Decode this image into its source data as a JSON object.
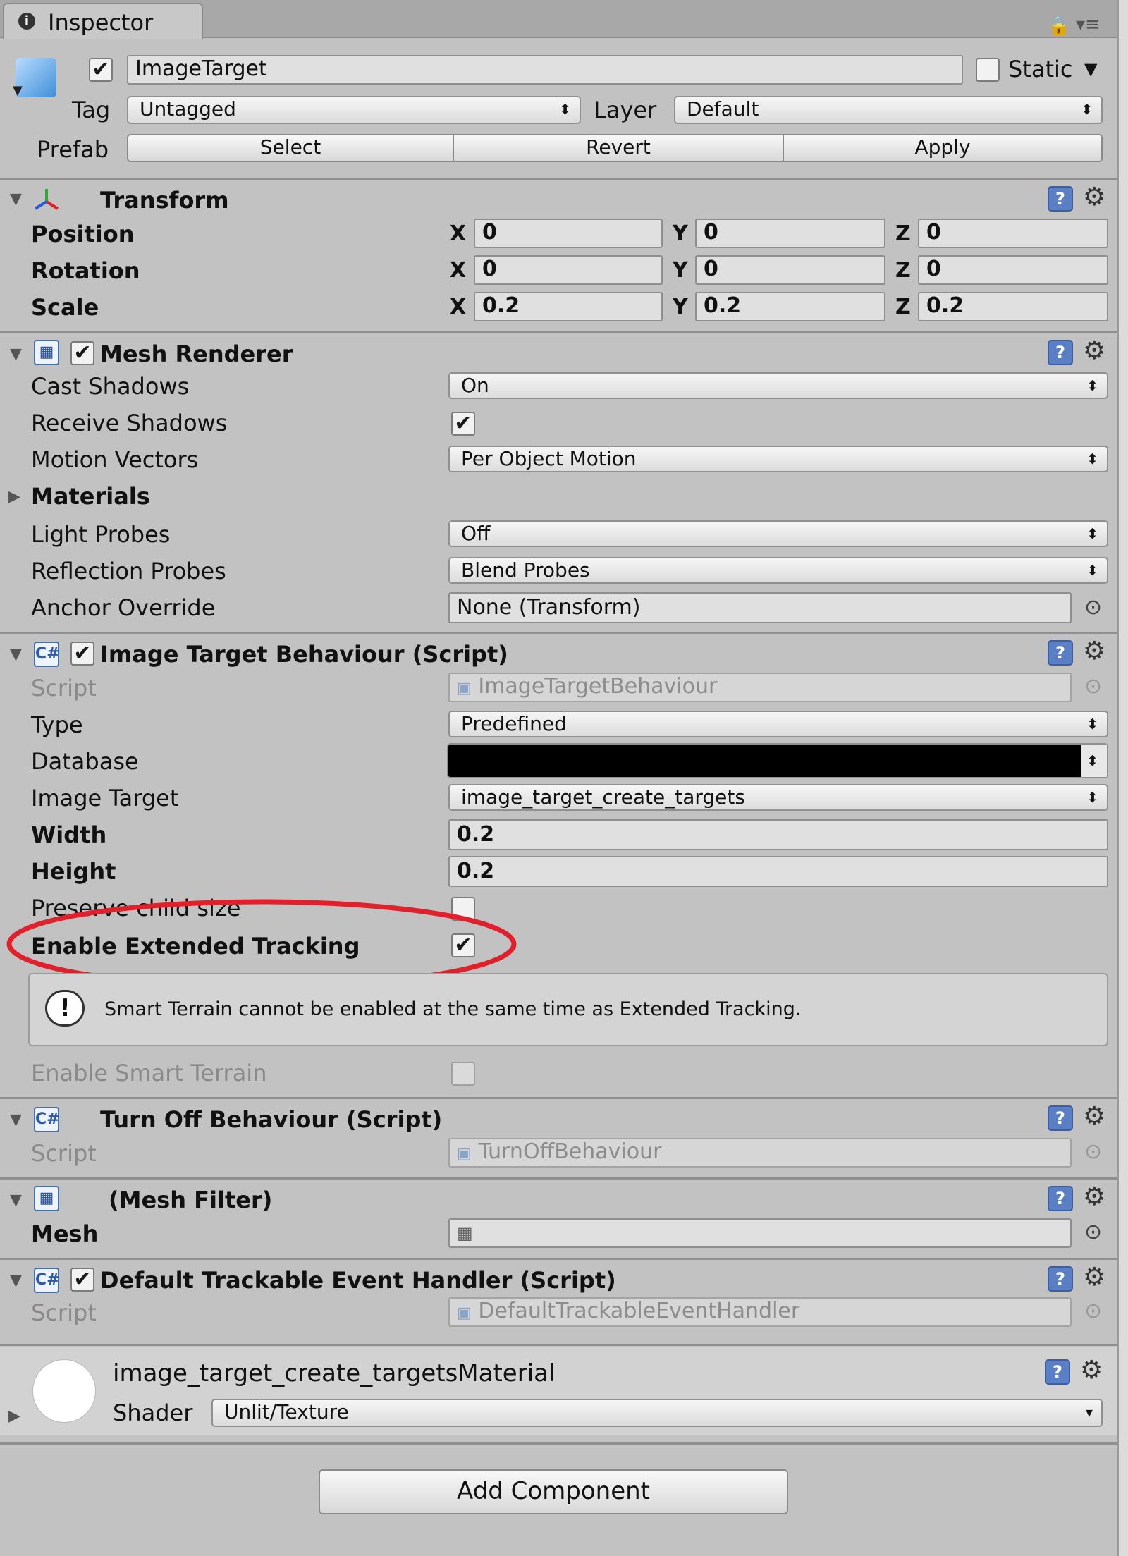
{
  "tab": {
    "title": "Inspector"
  },
  "header": {
    "object_name": "ImageTarget",
    "active": true,
    "static_label": "Static",
    "tag_label": "Tag",
    "tag_value": "Untagged",
    "layer_label": "Layer",
    "layer_value": "Default",
    "prefab_label": "Prefab",
    "prefab_buttons": [
      "Select",
      "Revert",
      "Apply"
    ]
  },
  "transform": {
    "title": "Transform",
    "rows": [
      {
        "label": "Position",
        "x": "0",
        "y": "0",
        "z": "0"
      },
      {
        "label": "Rotation",
        "x": "0",
        "y": "0",
        "z": "0"
      },
      {
        "label": "Scale",
        "x": "0.2",
        "y": "0.2",
        "z": "0.2"
      }
    ],
    "axis_labels": [
      "X",
      "Y",
      "Z"
    ]
  },
  "mesh_renderer": {
    "title": "Mesh Renderer",
    "cast_shadows_label": "Cast Shadows",
    "cast_shadows_value": "On",
    "receive_shadows_label": "Receive Shadows",
    "motion_vectors_label": "Motion Vectors",
    "motion_vectors_value": "Per Object Motion",
    "materials_label": "Materials",
    "light_probes_label": "Light Probes",
    "light_probes_value": "Off",
    "reflection_probes_label": "Reflection Probes",
    "reflection_probes_value": "Blend Probes",
    "anchor_override_label": "Anchor Override",
    "anchor_override_value": "None (Transform)"
  },
  "image_target_behaviour": {
    "title": "Image Target Behaviour (Script)",
    "script_label": "Script",
    "script_value": "ImageTargetBehaviour",
    "type_label": "Type",
    "type_value": "Predefined",
    "database_label": "Database",
    "image_target_label": "Image Target",
    "image_target_value": "image_target_create_targets",
    "width_label": "Width",
    "width_value": "0.2",
    "height_label": "Height",
    "height_value": "0.2",
    "preserve_label": "Preserve child size",
    "extended_tracking_label": "Enable Extended Tracking",
    "help_text": "Smart Terrain cannot be enabled at the same time as Extended Tracking.",
    "smart_terrain_label": "Enable Smart Terrain"
  },
  "turn_off_behaviour": {
    "title": "Turn Off Behaviour (Script)",
    "script_label": "Script",
    "script_value": "TurnOffBehaviour"
  },
  "mesh_filter": {
    "title": "(Mesh Filter)",
    "mesh_label": "Mesh"
  },
  "default_trackable": {
    "title": "Default Trackable Event Handler (Script)",
    "script_label": "Script",
    "script_value": "DefaultTrackableEventHandler"
  },
  "material": {
    "name": "image_target_create_targetsMaterial",
    "shader_label": "Shader",
    "shader_value": "Unlit/Texture"
  },
  "add_component_label": "Add Component",
  "colors": {
    "highlight_ellipse": "#e0202a",
    "help_icon": "#5b7fc4"
  }
}
